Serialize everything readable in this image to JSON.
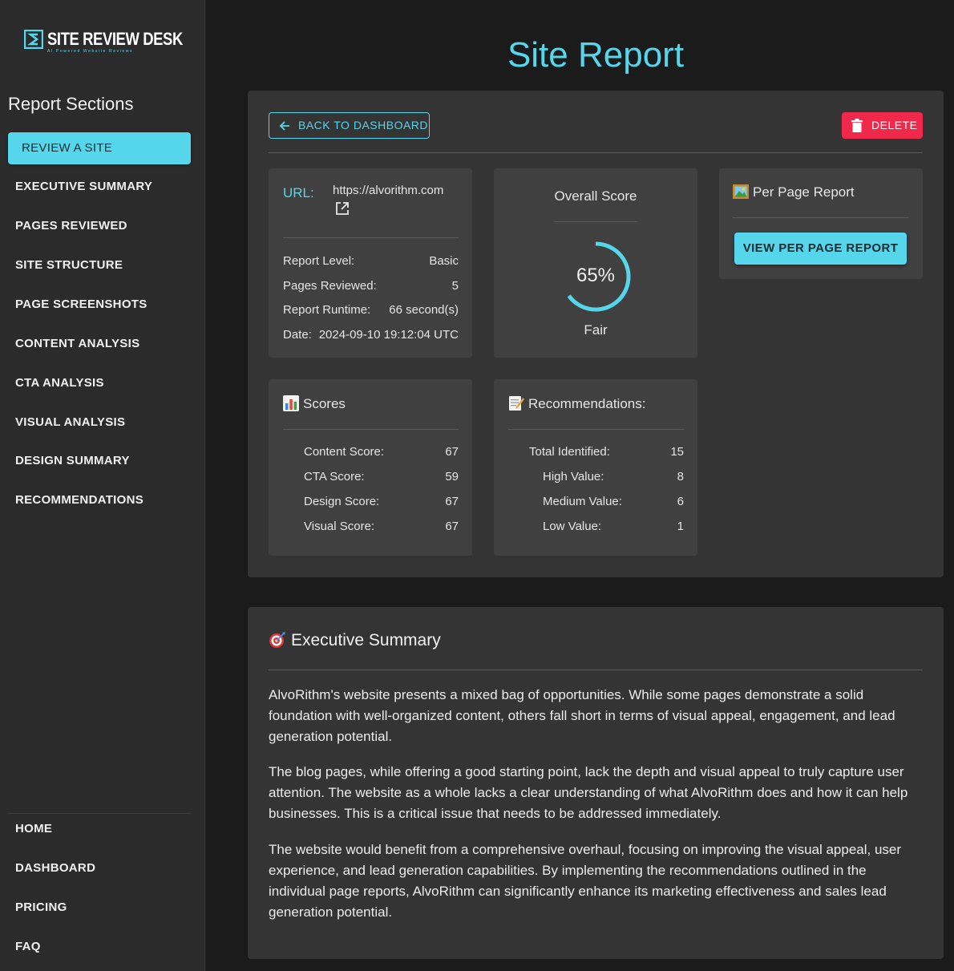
{
  "brand": {
    "name": "SITE REVIEW DESK",
    "tagline": "AI Powered Website Reviews",
    "accent": "#55d6ea"
  },
  "sidebar": {
    "heading": "Report Sections",
    "items": [
      {
        "label": "REVIEW A SITE",
        "active": true
      },
      {
        "label": "EXECUTIVE SUMMARY"
      },
      {
        "label": "PAGES REVIEWED"
      },
      {
        "label": "SITE STRUCTURE"
      },
      {
        "label": "PAGE SCREENSHOTS"
      },
      {
        "label": "CONTENT ANALYSIS"
      },
      {
        "label": "CTA ANALYSIS"
      },
      {
        "label": "VISUAL ANALYSIS"
      },
      {
        "label": "DESIGN SUMMARY"
      },
      {
        "label": "RECOMMENDATIONS"
      }
    ],
    "footer_items": [
      {
        "label": "HOME"
      },
      {
        "label": "DASHBOARD"
      },
      {
        "label": "PRICING"
      },
      {
        "label": "FAQ"
      }
    ]
  },
  "page": {
    "title": "Site Report",
    "back_label": "BACK TO DASHBOARD",
    "delete_label": "DELETE",
    "delete_color": "#f0284a"
  },
  "info": {
    "url_label": "URL:",
    "url": "https://alvorithm.com",
    "rows": [
      {
        "label": "Report Level:",
        "value": "Basic"
      },
      {
        "label": "Pages Reviewed:",
        "value": "5"
      },
      {
        "label": "Report Runtime:",
        "value": "66 second(s)"
      },
      {
        "label": "Date:",
        "value": "2024-09-10 19:12:04 UTC"
      }
    ]
  },
  "overall": {
    "title": "Overall Score",
    "percent": 65,
    "percent_label": "65%",
    "rating": "Fair"
  },
  "per_page": {
    "icon": "framed-picture-icon",
    "title": "Per Page Report",
    "button": "VIEW PER PAGE REPORT"
  },
  "scores": {
    "icon": "bar-chart-icon",
    "title": "Scores",
    "rows": [
      {
        "label": "Content Score:",
        "value": "67"
      },
      {
        "label": "CTA Score:",
        "value": "59"
      },
      {
        "label": "Design Score:",
        "value": "67"
      },
      {
        "label": "Visual Score:",
        "value": "67"
      }
    ]
  },
  "recommendations": {
    "icon": "memo-icon",
    "title": "Recommendations:",
    "rows": [
      {
        "label": "Total Identified:",
        "value": "15"
      },
      {
        "label": "High Value:",
        "value": "8"
      },
      {
        "label": "Medium Value:",
        "value": "6"
      },
      {
        "label": "Low Value:",
        "value": "1"
      }
    ]
  },
  "summary": {
    "icon": "target-icon",
    "title": "Executive Summary",
    "paragraphs": [
      "AlvoRithm's website presents a mixed bag of opportunities. While some pages demonstrate a solid foundation with well-organized content, others fall short in terms of visual appeal, engagement, and lead generation potential.",
      "The blog pages, while offering a good starting point, lack the depth and visual appeal to truly capture user attention. The website as a whole lacks a clear understanding of what AlvoRithm does and how it can help businesses. This is a critical issue that needs to be addressed immediately.",
      "The website would benefit from a comprehensive overhaul, focusing on improving the visual appeal, user experience, and lead generation capabilities. By implementing the recommendations outlined in the individual page reports, AlvoRithm can significantly enhance its marketing effectiveness and sales lead generation potential."
    ]
  }
}
